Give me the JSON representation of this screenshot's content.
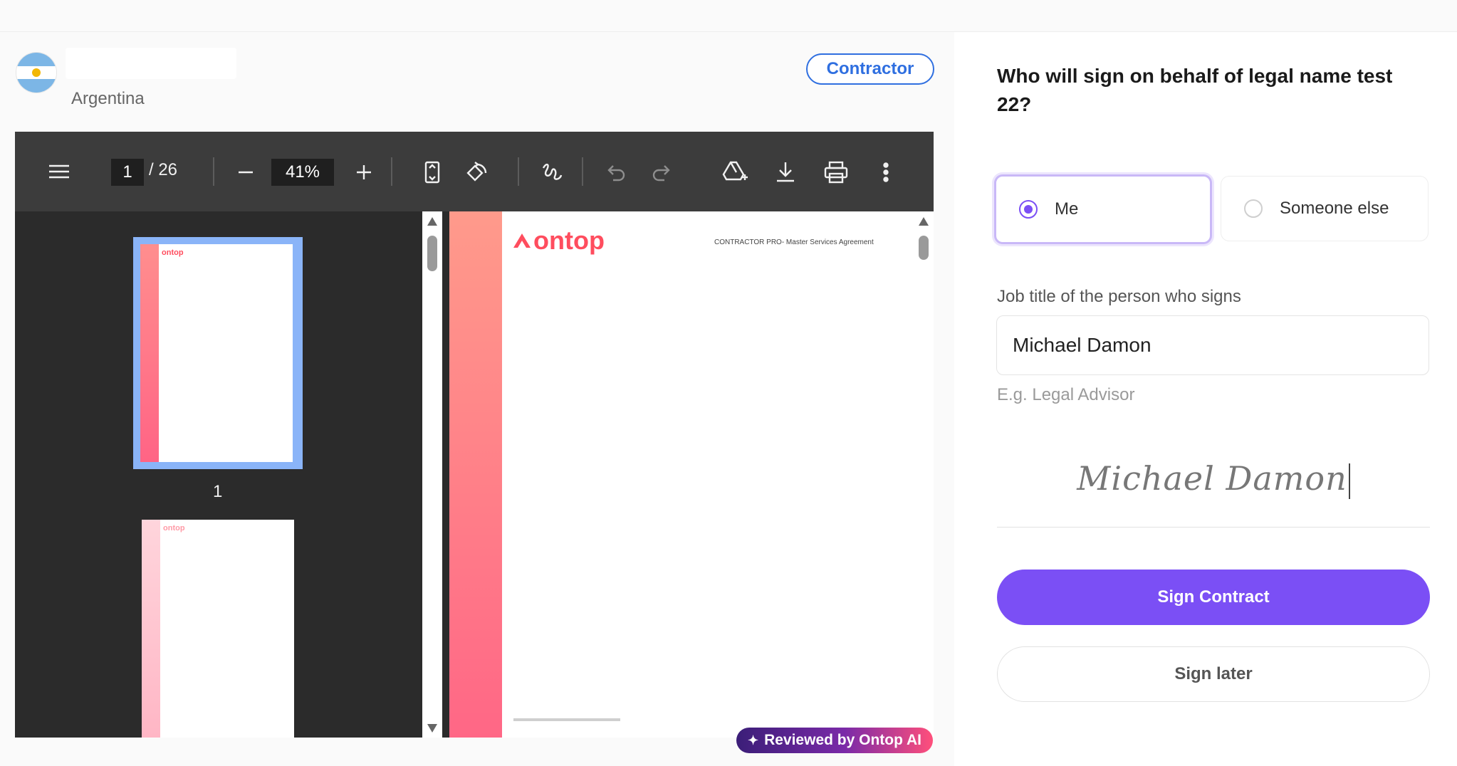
{
  "contract": {
    "country": "Argentina",
    "role_badge": "Contractor"
  },
  "pdf": {
    "current_page": "1",
    "total_pages": "/ 26",
    "zoom": "41%",
    "thumbnail_number": "1",
    "logo_text": "ontop",
    "document_header": "CONTRACTOR PRO- Master Services Agreement"
  },
  "ai_badge": "Reviewed by Ontop AI",
  "signer": {
    "question": "Who will sign on behalf of legal name test 22?",
    "option_me": "Me",
    "option_someone_else": "Someone else",
    "job_title_label": "Job title of the person who signs",
    "job_title_value": "Michael Damon",
    "job_title_hint": "E.g. Legal Advisor",
    "signature_text": "Michael Damon",
    "sign_button": "Sign Contract",
    "later_button": "Sign later"
  },
  "colors": {
    "accent": "#7b4ff5",
    "badge_blue": "#2f6fe0",
    "brand_red": "#ff4d5e"
  }
}
